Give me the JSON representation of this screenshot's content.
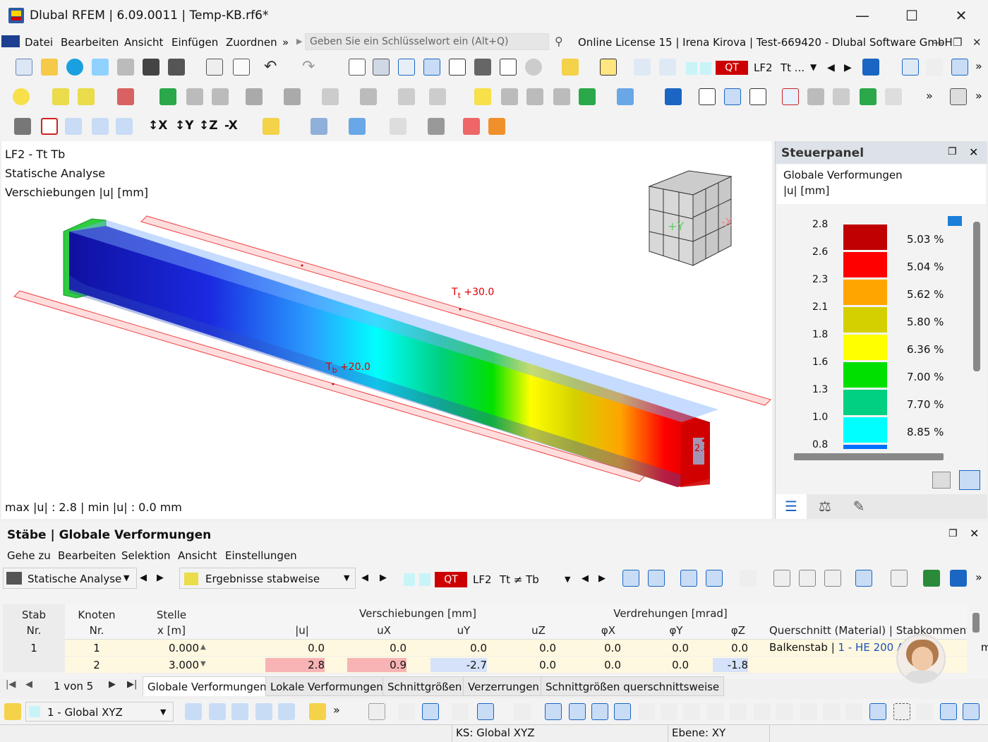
{
  "window": {
    "title": "Dlubal RFEM | 6.09.0011 | Temp-KB.rf6*"
  },
  "menu": {
    "items": [
      "Datei",
      "Bearbeiten",
      "Ansicht",
      "Einfügen",
      "Zuordnen"
    ],
    "more": "»",
    "search_placeholder": "Geben Sie ein Schlüsselwort ein (Alt+Q)",
    "license": "Online License 15 | Irena Kirova | Test-669420 - Dlubal Software GmbH"
  },
  "toolbar": {
    "lc_badge": "QT",
    "lc_name": "LF2",
    "lc_desc": "Tt ..."
  },
  "viewport": {
    "line1": "LF2 - Tt  Tb",
    "line2": "Statische Analyse",
    "line3": "Verschiebungen |u| [mm]",
    "tt_label": "+30.0",
    "tt_sym": "T",
    "tt_sub": "t",
    "tb_label": "+20.0",
    "tb_sym": "T",
    "tb_sub": "b",
    "max_label": "2.8",
    "summary": "max |u| : 2.8 | min |u| : 0.0 mm"
  },
  "panel": {
    "title": "Steuerpanel",
    "subtitle1": "Globale Verformungen",
    "subtitle2": "|u| [mm]",
    "values": [
      "2.8",
      "2.6",
      "2.3",
      "2.1",
      "1.8",
      "1.6",
      "1.3",
      "1.0",
      "0.8"
    ],
    "percents": [
      "5.03 %",
      "5.04 %",
      "5.62 %",
      "5.80 %",
      "6.36 %",
      "7.00 %",
      "7.70 %",
      "8.85 %"
    ],
    "colors": [
      "#c00000",
      "#ff0000",
      "#ffa500",
      "#d4d000",
      "#ffff00",
      "#00e000",
      "#00d080",
      "#00ffff",
      "#0070ff"
    ]
  },
  "results": {
    "title": "Stäbe | Globale Verformungen",
    "menu": [
      "Gehe zu",
      "Bearbeiten",
      "Selektion",
      "Ansicht",
      "Einstellungen"
    ],
    "analysis": "Statische Analyse",
    "mode": "Ergebnisse stabweise",
    "lc_badge": "QT",
    "lc_name": "LF2",
    "lc_desc": "Tt ≠ Tb",
    "group_headers": {
      "verschiebungen": "Verschiebungen [mm]",
      "verdrehungen": "Verdrehungen [mrad]"
    },
    "col_headers": {
      "stab": "Stab",
      "stab_nr": "Nr.",
      "knoten": "Knoten",
      "knoten_nr": "Nr.",
      "stelle": "Stelle",
      "stelle_x": "x [m]",
      "u": "|u|",
      "ux": "uX",
      "uy": "uY",
      "uz": "uZ",
      "phix": "φX",
      "phiy": "φY",
      "phiz": "φZ",
      "qs": "Querschnitt (Material) | Stabkommentar"
    },
    "rows": [
      {
        "stab": "1",
        "knoten": "1",
        "x": "0.000",
        "u": "0.0",
        "ux": "0.0",
        "uy": "0.0",
        "uz": "0.0",
        "phix": "0.0",
        "phiy": "0.0",
        "phiz": "0.0",
        "qs_a": "Balkenstab | ",
        "qs_b": "1 - HE 200 A | ",
        "qs_c": "m"
      },
      {
        "stab": "",
        "knoten": "2",
        "x": "3.000",
        "u": "2.8",
        "ux": "0.9",
        "uy": "-2.7",
        "uz": "0.0",
        "phix": "0.0",
        "phiy": "0.0",
        "phiz": "-1.8",
        "qs_a": "",
        "qs_b": "",
        "qs_c": ""
      }
    ],
    "pager": "1 von 5",
    "tabs": [
      "Globale Verformungen",
      "Lokale Verformungen",
      "Schnittgrößen",
      "Verzerrungen",
      "Schnittgrößen querschnittsweise"
    ]
  },
  "bottom": {
    "cs": "1 - Global XYZ"
  },
  "status": {
    "ks": "KS: Global XYZ",
    "ebene": "Ebene: XY"
  }
}
